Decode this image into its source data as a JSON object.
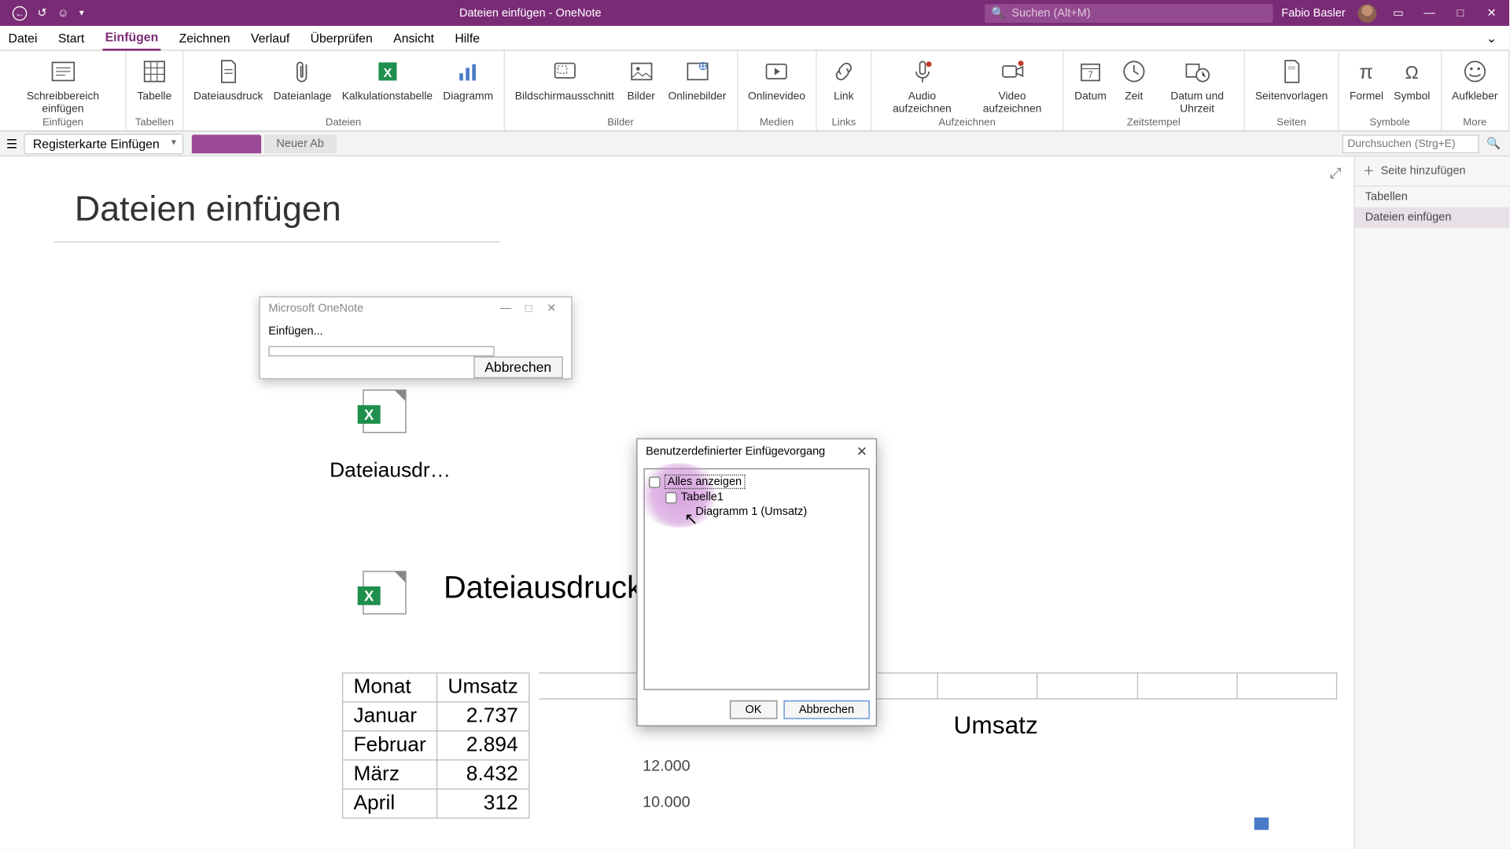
{
  "titlebar": {
    "doc": "Dateien einfügen",
    "app": "OneNote",
    "search_placeholder": "Suchen (Alt+M)",
    "user": "Fabio Basler"
  },
  "menu": {
    "items": [
      "Datei",
      "Start",
      "Einfügen",
      "Zeichnen",
      "Verlauf",
      "Überprüfen",
      "Ansicht",
      "Hilfe"
    ],
    "active_index": 2
  },
  "ribbon": {
    "groups": [
      {
        "name": "Einfügen",
        "items": [
          {
            "label": "Schreibbereich einfügen"
          }
        ]
      },
      {
        "name": "Tabellen",
        "items": [
          {
            "label": "Tabelle"
          }
        ]
      },
      {
        "name": "Dateien",
        "items": [
          {
            "label": "Dateiausdruck"
          },
          {
            "label": "Dateianlage"
          },
          {
            "label": "Kalkulationstabelle"
          },
          {
            "label": "Diagramm"
          }
        ]
      },
      {
        "name": "Bilder",
        "items": [
          {
            "label": "Bildschirmausschnitt"
          },
          {
            "label": "Bilder"
          },
          {
            "label": "Onlinebilder"
          }
        ]
      },
      {
        "name": "Medien",
        "items": [
          {
            "label": "Onlinevideo"
          }
        ]
      },
      {
        "name": "Links",
        "items": [
          {
            "label": "Link"
          }
        ]
      },
      {
        "name": "Aufzeichnen",
        "items": [
          {
            "label": "Audio aufzeichnen"
          },
          {
            "label": "Video aufzeichnen"
          }
        ]
      },
      {
        "name": "Zeitstempel",
        "items": [
          {
            "label": "Datum"
          },
          {
            "label": "Zeit"
          },
          {
            "label": "Datum und Uhrzeit"
          }
        ]
      },
      {
        "name": "Seiten",
        "items": [
          {
            "label": "Seitenvorlagen"
          }
        ]
      },
      {
        "name": "Symbole",
        "items": [
          {
            "label": "Formel"
          },
          {
            "label": "Symbol"
          }
        ]
      },
      {
        "name": "More",
        "items": [
          {
            "label": "Aufkleber"
          }
        ]
      }
    ]
  },
  "notebook": {
    "name": "Registerkarte Einfügen",
    "section_active": "",
    "section_other": "Neuer Ab",
    "search_placeholder": "Durchsuchen (Strg+E)"
  },
  "pagelist": {
    "add": "Seite hinzufügen",
    "pages": [
      "Tabellen",
      "Dateien einfügen"
    ],
    "selected_index": 1
  },
  "page": {
    "title": "Dateien einfügen",
    "file1_label": "Dateiausdr…",
    "file2_label": "Dateiausdruck"
  },
  "chart_data": {
    "type": "bar",
    "title": "Umsatz",
    "columns": [
      "Monat",
      "Umsatz"
    ],
    "categories": [
      "Januar",
      "Februar",
      "März",
      "April"
    ],
    "values": [
      2737,
      2894,
      8432,
      312
    ],
    "display_values": [
      "2.737",
      "2.894",
      "8.432",
      "312"
    ],
    "y_ticks": [
      "12.000",
      "10.000"
    ],
    "ylim": [
      0,
      12000
    ]
  },
  "progress_dialog": {
    "title": "Microsoft OneNote",
    "status": "Einfügen...",
    "cancel": "Abbrechen"
  },
  "custom_dialog": {
    "title": "Benutzerdefinierter Einfügevorgang",
    "tree": {
      "root": "Alles anzeigen",
      "lvl1": "Tabelle1",
      "lvl2": "Diagramm 1 (Umsatz)"
    },
    "ok": "OK",
    "cancel": "Abbrechen"
  }
}
